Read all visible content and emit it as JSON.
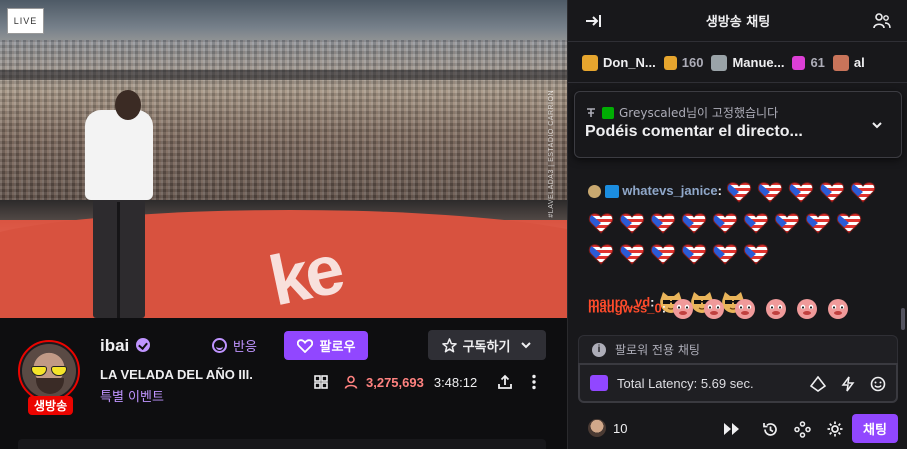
{
  "video": {
    "live_badge": "LIVE",
    "watermark": "#LAVELADA3 | ESTADIO CARRION"
  },
  "channel": {
    "name": "ibai",
    "live_tag": "생방송",
    "title": "LA VELADA DEL AÑO III.",
    "category": "특별 이벤트",
    "react_label": "반응",
    "follow_label": "팔로우",
    "subscribe_label": "구독하기",
    "viewer_count": "3,275,693",
    "uptime": "3:48:12"
  },
  "chat": {
    "header_title": "생방송 채팅",
    "gifters": [
      {
        "name": "Don_N...",
        "count": "160",
        "color": "#e6a52e"
      },
      {
        "name": "Manue...",
        "count": "61",
        "color": "#dc3fd6"
      },
      {
        "name": "al",
        "count": "",
        "color": "#c8745a"
      }
    ],
    "pinned": {
      "pinned_by_user": "Greyscaled",
      "pinned_by_suffix": "님이 고정했습니다",
      "message": "Podéis comentar el directo..."
    },
    "messages": [
      {
        "user": "whatevs_janice",
        "color": "#8fa7c9",
        "emote_count": 20
      },
      {
        "user": "mauro_vd",
        "color": "#ff4b2b",
        "emote_count": 3
      },
      {
        "user": "maugwss_0",
        "color": "#ff4b2b",
        "emote_count": 6
      }
    ],
    "followers_only": "팔로워 전용 채팅",
    "input_text": "Total Latency: 5.69 sec.",
    "points": "10",
    "send_label": "채팅"
  },
  "colors": {
    "accent": "#9147ff",
    "live_red": "#eb0400",
    "viewer_red": "#ff8280",
    "link_purple": "#bf94ff"
  }
}
